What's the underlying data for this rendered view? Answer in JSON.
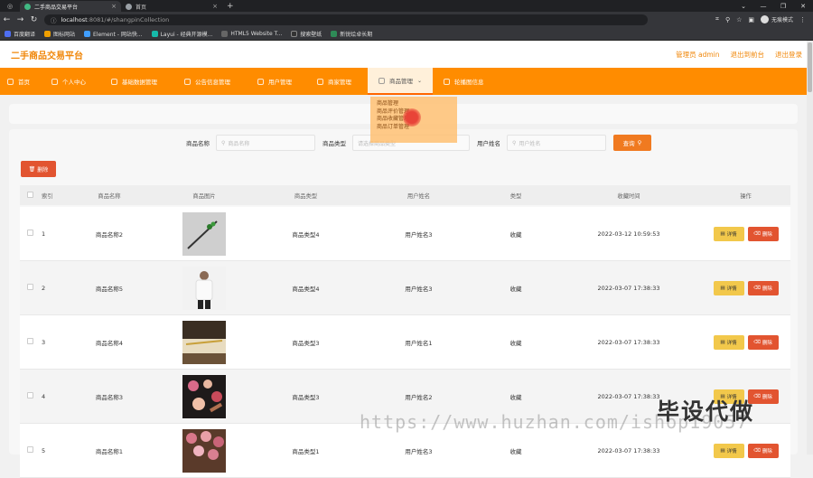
{
  "browser": {
    "tabs": [
      {
        "title": "二手商品交易平台",
        "fav_color": "#41b883"
      },
      {
        "title": "首页",
        "fav_color": "#9aa0a6"
      }
    ],
    "url_host": "localhost",
    "url_rest": ":8081/#/shangpinCollection",
    "profile": "无痕模式",
    "bookmarks": [
      {
        "label": "百度翻译",
        "color": "#4e6ef2"
      },
      {
        "label": "图标网站",
        "color": "#f0a000"
      },
      {
        "label": "Element - 网站快...",
        "color": "#409eff"
      },
      {
        "label": "Layui - 经典开源模...",
        "color": "#16baaa"
      },
      {
        "label": "HTML5 Website T...",
        "color": "#666"
      },
      {
        "label": "搜索壁纸",
        "color": "#333"
      },
      {
        "label": "新锐绘卓长期",
        "color": "#2e8b57"
      }
    ]
  },
  "app": {
    "brand": "二手商品交易平台",
    "admin": "管理员 admin",
    "back": "退出到前台",
    "logout": "退出登录"
  },
  "nav": [
    "首页",
    "个人中心",
    "基础数据管理",
    "公告信息管理",
    "用户管理",
    "商家管理",
    "商品管理",
    "轮播图信息"
  ],
  "dropdown": [
    "商品管理",
    "商品评价管理",
    "商品收藏管理",
    "商品订单管理"
  ],
  "search": {
    "fields": [
      {
        "label": "商品名称",
        "placeholder": "商品名称"
      },
      {
        "label": "商品类型",
        "placeholder": "请选择商品类型"
      },
      {
        "label": "用户姓名",
        "placeholder": "用户姓名"
      }
    ],
    "query_button": "查询",
    "delete_button": "删除"
  },
  "table": {
    "headers": [
      "索引",
      "商品名称",
      "商品图片",
      "商品类型",
      "用户姓名",
      "类型",
      "收藏时间",
      "操作"
    ],
    "rows": [
      {
        "idx": "1",
        "name": "商品名称2",
        "type": "商品类型4",
        "user": "用户姓名3",
        "kind": "收藏",
        "time": "2022-03-12 10:59:53"
      },
      {
        "idx": "2",
        "name": "商品名称5",
        "type": "商品类型4",
        "user": "用户姓名3",
        "kind": "收藏",
        "time": "2022-03-07 17:38:33"
      },
      {
        "idx": "3",
        "name": "商品名称4",
        "type": "商品类型3",
        "user": "用户姓名1",
        "kind": "收藏",
        "time": "2022-03-07 17:38:33"
      },
      {
        "idx": "4",
        "name": "商品名称3",
        "type": "商品类型3",
        "user": "用户姓名2",
        "kind": "收藏",
        "time": "2022-03-07 17:38:33"
      },
      {
        "idx": "5",
        "name": "商品名称1",
        "type": "商品类型1",
        "user": "用户姓名3",
        "kind": "收藏",
        "time": "2022-03-07 17:38:33"
      }
    ],
    "detail_label": "详情",
    "delete_label": "删除"
  },
  "watermark": {
    "url": "https://www.huzhan.com/ishop19057",
    "cn": "毕设代做"
  }
}
